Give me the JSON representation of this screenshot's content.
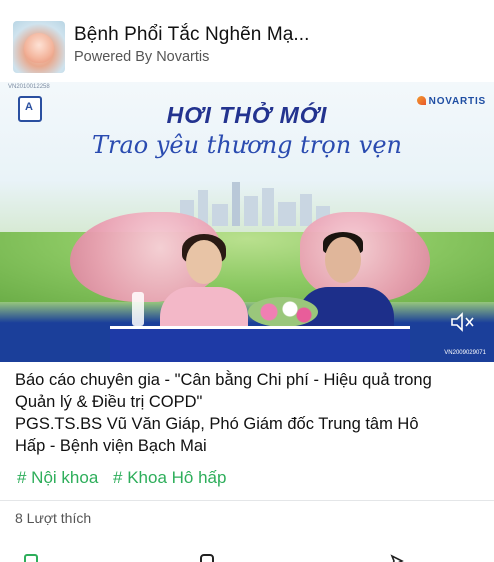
{
  "post": {
    "page_name": "Bệnh Phổi Tắc Nghẽn Mạ...",
    "powered_by": "Powered By Novartis",
    "avatar_icon": "hands-avatar-icon"
  },
  "video": {
    "code_top": "VN2010012258",
    "code_bottom": "VN2009029071",
    "headline": "HƠI THỞ MỚI",
    "subheadline": "Trao yêu thương trọn vẹn",
    "brand": "NOVARTIS",
    "mute_icon": "speaker-muted-icon"
  },
  "caption": {
    "line1": "Báo cáo chuyên gia - \"Cân bằng Chi phí - Hiệu quả trong",
    "line2": "Quản lý & Điều trị COPD\"",
    "line3": "PGS.TS.BS Vũ Văn Giáp, Phó Giám đốc Trung tâm Hô",
    "line4": "Hấp - Bệnh viện Bạch Mai"
  },
  "tags": [
    "# Nội khoa",
    "# Khoa Hô hấp"
  ],
  "likes": "8 Lượt thích",
  "colors": {
    "hashtag": "#2eae5b",
    "brand_blue": "#1f4ea3",
    "stage_blue": "#1e3aa6"
  }
}
